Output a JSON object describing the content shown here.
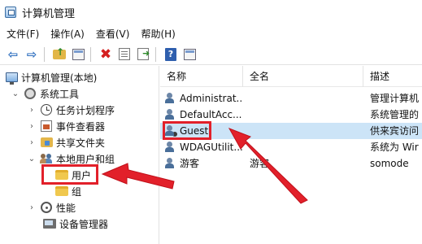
{
  "window": {
    "title": "计算机管理",
    "icon": "computer-management-icon"
  },
  "menu": [
    "文件(F)",
    "操作(A)",
    "查看(V)",
    "帮助(H)"
  ],
  "toolbar": {
    "buttons": [
      "back-arrow-icon",
      "forward-arrow-icon",
      "up-folder-icon",
      "show-hide-tree-icon",
      "delete-icon",
      "properties-icon",
      "export-list-icon",
      "help-icon",
      "view-icon"
    ],
    "help_glyph": "?"
  },
  "tree": {
    "root": "计算机管理(本地)",
    "system_tools": "系统工具",
    "task_scheduler": "任务计划程序",
    "event_viewer": "事件查看器",
    "shared_folders": "共享文件夹",
    "local_users_groups": "本地用户和组",
    "users": "用户",
    "groups": "组",
    "performance": "性能",
    "device_manager": "设备管理器",
    "chevron_right": "›",
    "chevron_down": "⌄"
  },
  "list": {
    "columns": [
      "名称",
      "全名",
      "描述"
    ],
    "rows": [
      {
        "name": "Administrat...",
        "full_name": "",
        "description": "管理计算机"
      },
      {
        "name": "DefaultAcc...",
        "full_name": "",
        "description": "系统管理的"
      },
      {
        "name": "Guest",
        "full_name": "",
        "description": "供来宾访问"
      },
      {
        "name": "WDAGUtilit...",
        "full_name": "",
        "description": "系统为 Wir"
      },
      {
        "name": "游客",
        "full_name": "游客",
        "description": "somode"
      }
    ],
    "selected_index": 2
  },
  "annotations": {
    "highlight_color": "#e2202a"
  }
}
